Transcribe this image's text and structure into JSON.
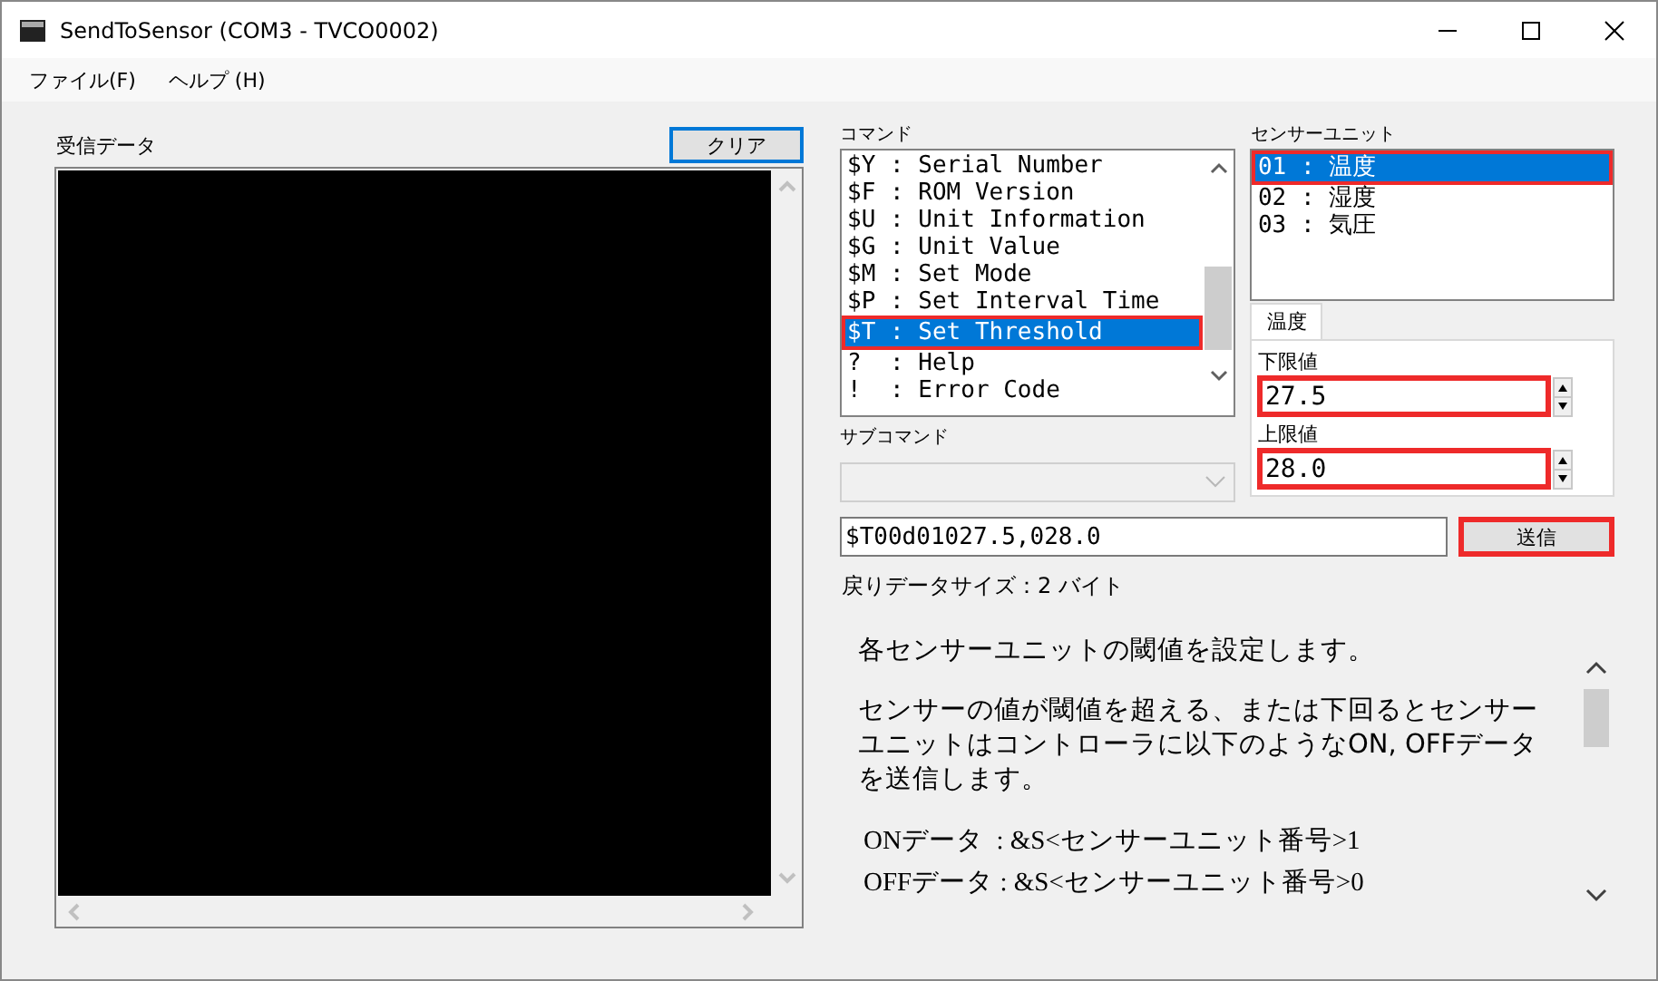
{
  "window": {
    "title": "SendToSensor (COM3 - TVCO0002)"
  },
  "menu": [
    {
      "label": "ファイル(F)"
    },
    {
      "label": "ヘルプ (H)"
    }
  ],
  "received": {
    "label": "受信データ",
    "clear_button": "クリア"
  },
  "commands": {
    "label": "コマンド",
    "items": [
      {
        "text": "$Y : Serial Number",
        "selected": false
      },
      {
        "text": "$F : ROM Version",
        "selected": false
      },
      {
        "text": "$U : Unit Information",
        "selected": false
      },
      {
        "text": "$G : Unit Value",
        "selected": false
      },
      {
        "text": "$M : Set Mode",
        "selected": false
      },
      {
        "text": "$P : Set Interval Time",
        "selected": false
      },
      {
        "text": "$T : Set Threshold",
        "selected": true
      },
      {
        "text": "?  : Help",
        "selected": false
      },
      {
        "text": "!  : Error Code",
        "selected": false
      }
    ]
  },
  "sensor_units": {
    "label": "センサーユニット",
    "items": [
      {
        "text": "01 : 温度",
        "selected": true
      },
      {
        "text": "02 : 湿度",
        "selected": false
      },
      {
        "text": "03 : 気圧",
        "selected": false
      }
    ]
  },
  "threshold_tab": {
    "label": "温度",
    "fields": [
      {
        "label": "下限値",
        "value": "27.5",
        "highlighted": true
      },
      {
        "label": "上限値",
        "value": "28.0",
        "highlighted": true
      }
    ]
  },
  "subcommand": {
    "label": "サブコマンド",
    "disabled": true
  },
  "command_field": {
    "value": "$T00d01027.5,028.0"
  },
  "send_button": {
    "label": "送信",
    "highlighted": true
  },
  "return_size": "戻りデータサイズ：2 バイト",
  "description": {
    "paragraphs": [
      "各センサーユニットの閾値を設定します。",
      "センサーの値が閾値を超える、または下回るとセンサーユニットはコントローラに以下のようなON, OFFデータを送信します。"
    ],
    "code_lines": [
      "ONデータ  : &S<センサーユニット番号>1",
      "OFFデータ : &S<センサーユニット番号>0"
    ]
  }
}
